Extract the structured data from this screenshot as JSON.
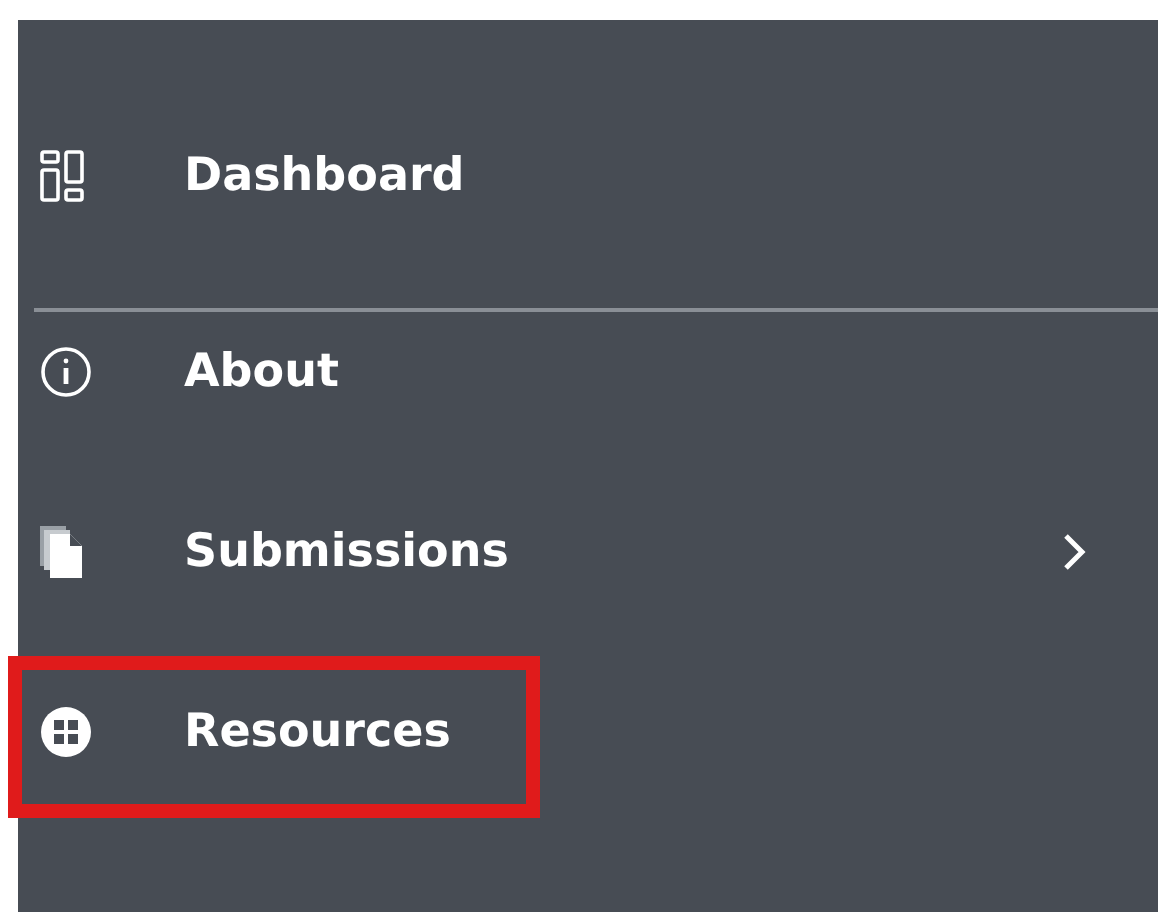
{
  "nav": {
    "items": [
      {
        "kind": "dashboard",
        "label": "Dashboard",
        "has_submenu": false,
        "highlighted": false,
        "divider_after": true
      },
      {
        "kind": "about",
        "label": "About",
        "has_submenu": false,
        "highlighted": false,
        "divider_after": false
      },
      {
        "kind": "submissions",
        "label": "Submissions",
        "has_submenu": true,
        "highlighted": false,
        "divider_after": false
      },
      {
        "kind": "resources",
        "label": "Resources",
        "has_submenu": false,
        "highlighted": true,
        "divider_after": false
      }
    ]
  }
}
